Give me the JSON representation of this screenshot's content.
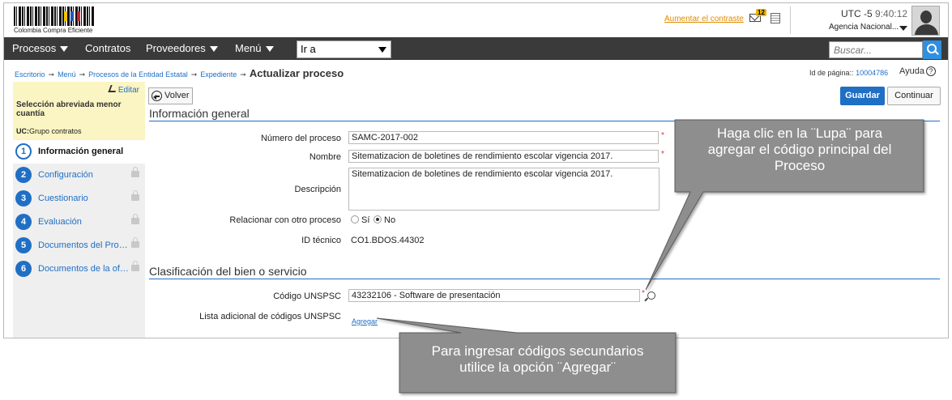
{
  "header": {
    "logo_text": "Colombia Compra Eficiente",
    "contrast_link": "Aumentar el contraste",
    "mail_count": "12",
    "timezone": "UTC -5",
    "time": "9:40:12",
    "agency": "Agencia Nacional..."
  },
  "nav": {
    "items": [
      "Procesos",
      "Contratos",
      "Proveedores",
      "Menú"
    ],
    "ira_label": "Ir a",
    "search_placeholder": "Buscar..."
  },
  "breadcrumb": {
    "items": [
      "Escritorio",
      "Menú",
      "Procesos de la Entidad Estatal",
      "Expediente"
    ],
    "current": "Actualizar proceso",
    "page_id_label": "Id de página::",
    "page_id": "10004786",
    "help_label": "Ayuda",
    "help_icon": "?"
  },
  "sidebar": {
    "edit_label": "Editar",
    "title": "Selección abreviada menor cuantía",
    "uc_label": "UC:",
    "uc_value": "Grupo contratos",
    "steps": [
      {
        "num": "1",
        "label": "Información general"
      },
      {
        "num": "2",
        "label": "Configuración"
      },
      {
        "num": "3",
        "label": "Cuestionario"
      },
      {
        "num": "4",
        "label": "Evaluación"
      },
      {
        "num": "5",
        "label": "Documentos del Proc..."
      },
      {
        "num": "6",
        "label": "Documentos de la ofe..."
      }
    ]
  },
  "toolbar": {
    "back_label": "Volver",
    "save_label": "Guardar",
    "continue_label": "Continuar"
  },
  "general": {
    "section_title": "Información general",
    "process_number_label": "Número del proceso",
    "process_number_value": "SAMC-2017-002",
    "name_label": "Nombre",
    "name_value": "Sitematizacion de boletines de rendimiento escolar vigencia 2017.",
    "description_label": "Descripción",
    "description_value": "Sitematizacion de boletines de rendimiento escolar vigencia 2017.",
    "relate_label": "Relacionar con otro proceso",
    "radio_yes": "Sí",
    "radio_no": "No",
    "technical_id_label": "ID técnico",
    "technical_id_value": "CO1.BDOS.44302",
    "required_mark": "*"
  },
  "classification": {
    "section_title": "Clasificación del bien o servicio",
    "unspsc_label": "Código UNSPSC",
    "unspsc_value": "43232106 - Software de presentación",
    "additional_label": "Lista adicional de códigos UNSPSC",
    "add_link": "Agregar"
  },
  "callouts": {
    "lupa_lines": [
      "Haga clic en la ¨Lupa¨ para",
      "agregar el código principal del",
      "Proceso"
    ],
    "agregar_lines": [
      "Para ingresar códigos secundarios",
      "utilice la opción ¨Agregar¨"
    ]
  },
  "colors": {
    "accent": "#1f6fc5",
    "nav_bg": "#3a3a3a",
    "sidebar_head_bg": "#fbf5c3",
    "callout_bg": "#8e8e8e"
  }
}
